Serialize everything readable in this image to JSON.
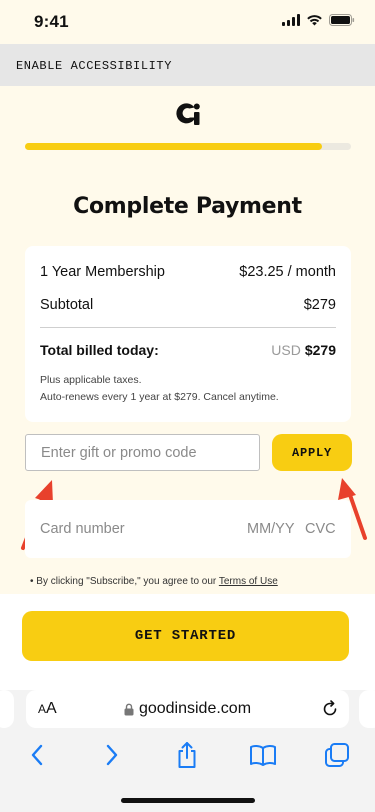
{
  "status_bar": {
    "time": "9:41"
  },
  "accessibility_bar": {
    "label": "ENABLE ACCESSIBILITY"
  },
  "progress": {
    "fraction": 0.91
  },
  "page": {
    "title": "Complete Payment"
  },
  "summary": {
    "membership_label": "1 Year Membership",
    "membership_price": "$23.25 / month",
    "subtotal_label": "Subtotal",
    "subtotal_value": "$279",
    "total_label": "Total billed today:",
    "total_currency": "USD",
    "total_value": "$279",
    "note_taxes": "Plus applicable taxes.",
    "note_renew": "Auto-renews every 1 year at $279. Cancel anytime."
  },
  "promo": {
    "placeholder": "Enter gift or promo code",
    "value": "",
    "apply_label": "APPLY"
  },
  "card": {
    "number_placeholder": "Card number",
    "exp_placeholder": "MM/YY",
    "cvc_placeholder": "CVC"
  },
  "terms": {
    "prefix": "By clicking \"Subscribe,\" you agree to our ",
    "link": "Terms of Use"
  },
  "cta": {
    "label": "GET STARTED"
  },
  "browser": {
    "text_size": "AA",
    "url": "goodinside.com"
  },
  "colors": {
    "accent": "#f8cd12",
    "background": "#fffaeb",
    "arrow": "#e8412c"
  },
  "icons": [
    "goodinside-logo",
    "lock-icon",
    "reload-icon",
    "back-icon",
    "forward-icon",
    "share-icon",
    "bookmarks-icon",
    "tabs-icon"
  ]
}
